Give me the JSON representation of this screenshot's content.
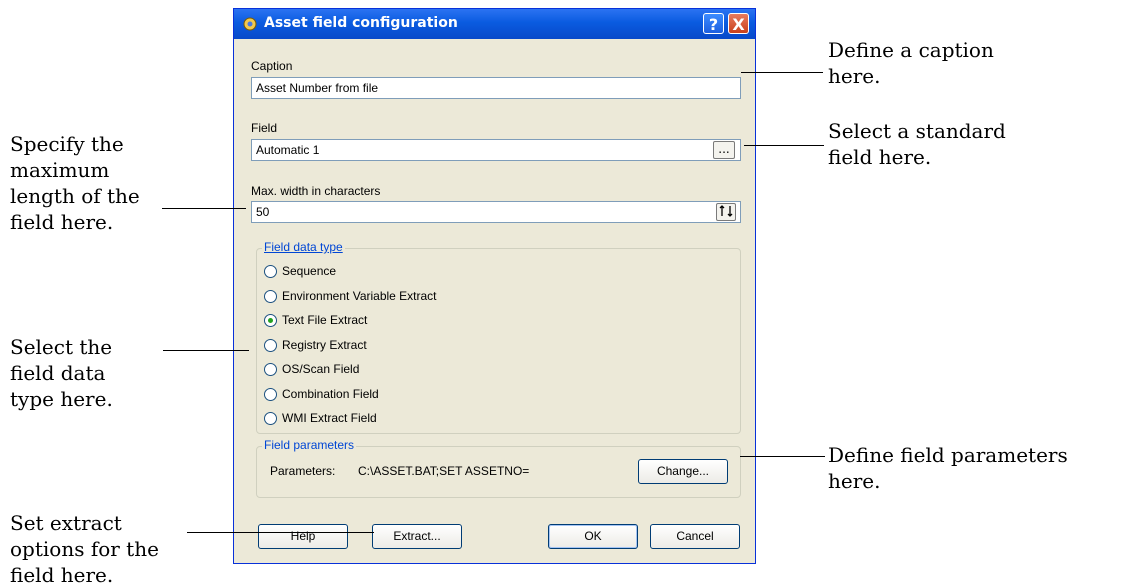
{
  "dialog": {
    "title": "Asset field configuration",
    "caption_label": "Caption",
    "caption_value": "Asset Number from file",
    "field_label": "Field",
    "field_value": "Automatic 1",
    "browse_glyph": "...",
    "maxwidth_label": "Max. width in characters",
    "maxwidth_value": "50",
    "data_type_group": {
      "title": "Field data type",
      "options": [
        {
          "label": "Sequence",
          "checked": false
        },
        {
          "label": "Environment Variable Extract",
          "checked": false
        },
        {
          "label": "Text File Extract",
          "checked": true
        },
        {
          "label": "Registry Extract",
          "checked": false
        },
        {
          "label": "OS/Scan Field",
          "checked": false
        },
        {
          "label": "Combination Field",
          "checked": false
        },
        {
          "label": "WMI Extract Field",
          "checked": false
        }
      ]
    },
    "params_group": {
      "title": "Field parameters",
      "params_label": "Parameters:",
      "params_value": "C:\\ASSET.BAT;SET ASSETNO=",
      "change_button": "Change..."
    },
    "buttons": {
      "help": "Help",
      "extract": "Extract...",
      "ok": "OK",
      "cancel": "Cancel"
    },
    "title_buttons": {
      "help": "?",
      "close": "X"
    }
  },
  "callouts": {
    "caption": [
      "Define a caption",
      "here."
    ],
    "standard_field": [
      "Select a standard",
      "field here."
    ],
    "max_length": [
      "Specify the",
      "maximum",
      "length of the",
      "field here."
    ],
    "data_type": [
      "Select the",
      "field data",
      "type here."
    ],
    "params": [
      "Define field parameters",
      "here."
    ],
    "extract": [
      "Set extract",
      "options for the",
      "field here."
    ]
  },
  "colors": {
    "titlebar": "#0A5BE0",
    "dialog_bg": "#ECE9D8",
    "group_title": "#0046D5",
    "radio_dot": "#21A121"
  },
  "icons": [
    "app-gear-icon",
    "help-icon",
    "close-icon",
    "ellipsis-icon",
    "spin-icon"
  ]
}
